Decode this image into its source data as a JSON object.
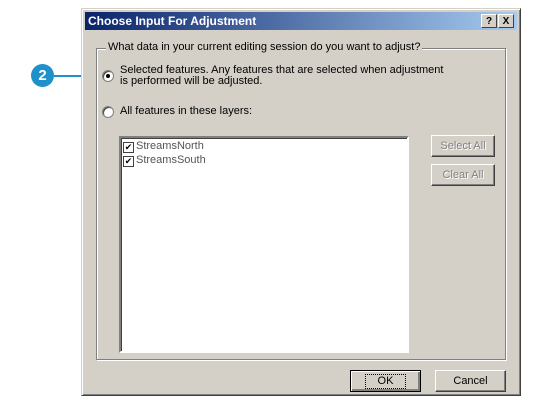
{
  "callout": {
    "number": "2"
  },
  "dialog": {
    "title": "Choose Input For Adjustment",
    "help_label": "?",
    "close_label": "X",
    "group_label": "What data in your current editing session do you want to adjust?",
    "option_selected": {
      "line1": "Selected features.  Any features that are selected when adjustment",
      "line2": "is performed will be adjusted.",
      "checked": true
    },
    "option_all": {
      "label": "All features in these layers:",
      "checked": false
    },
    "layers": [
      {
        "name": "StreamsNorth",
        "checked": true
      },
      {
        "name": "StreamsSouth",
        "checked": true
      }
    ],
    "select_all_label": "Select All",
    "clear_all_label": "Clear All",
    "ok_label": "OK",
    "cancel_label": "Cancel"
  }
}
